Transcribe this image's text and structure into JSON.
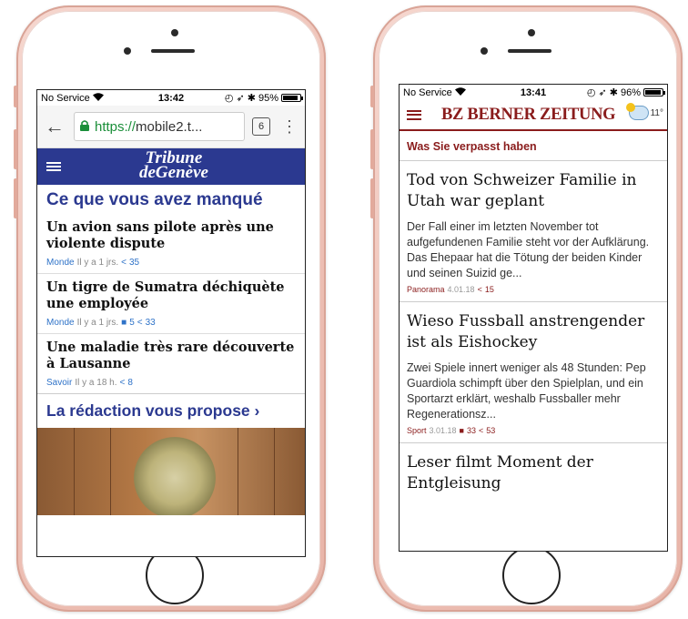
{
  "left_phone": {
    "status": {
      "carrier": "No Service",
      "time": "13:42",
      "battery": "95%",
      "battery_level": 0.95
    },
    "browser": {
      "url_prefix": "https://",
      "url_rest": "mobile2.t...",
      "tab_count": "6"
    },
    "header": {
      "logo_line1": "Tribune",
      "logo_line2": "deGenève"
    },
    "section_title": "Ce que vous avez manqué",
    "articles": [
      {
        "title": "Un avion sans pilote après une violente dispute",
        "category": "Monde",
        "time": "Il y a 1 jrs.",
        "comments": "",
        "shares": "35"
      },
      {
        "title": "Un tigre de Sumatra déchiquète une employée",
        "category": "Monde",
        "time": "Il y a 1 jrs.",
        "comments": "5",
        "shares": "33"
      },
      {
        "title": "Une maladie très rare découverte à Lausanne",
        "category": "Savoir",
        "time": "Il y a 18 h.",
        "comments": "",
        "shares": "8"
      }
    ],
    "propose_title": "La rédaction vous propose ›"
  },
  "right_phone": {
    "status": {
      "carrier": "No Service",
      "time": "13:41",
      "battery": "96%",
      "battery_level": 0.96
    },
    "header": {
      "logo": "BZ BERNER ZEITUNG",
      "temperature": "11°"
    },
    "section_title": "Was Sie verpasst haben",
    "articles": [
      {
        "title": "Tod von Schweizer Familie in Utah war geplant",
        "teaser": "Der Fall einer im letzten November tot aufgefundenen Familie steht vor der Aufklärung. Das Ehepaar hat die Tötung der beiden Kinder und seinen Suizid ge...",
        "category": "Panorama",
        "date": "4.01.18",
        "comments": "",
        "shares": "15"
      },
      {
        "title": "Wieso Fussball anstrengender ist als Eishockey",
        "teaser": "Zwei Spiele innert weniger als 48 Stunden: Pep Guardiola schimpft über den Spielplan, und ein Sportarzt erklärt, weshalb Fussballer mehr Regenerationsz...",
        "category": "Sport",
        "date": "3.01.18",
        "comments": "33",
        "shares": "53"
      },
      {
        "title": "Leser filmt Moment der Entgleisung",
        "teaser": "",
        "category": "",
        "date": "",
        "comments": "",
        "shares": ""
      }
    ]
  }
}
